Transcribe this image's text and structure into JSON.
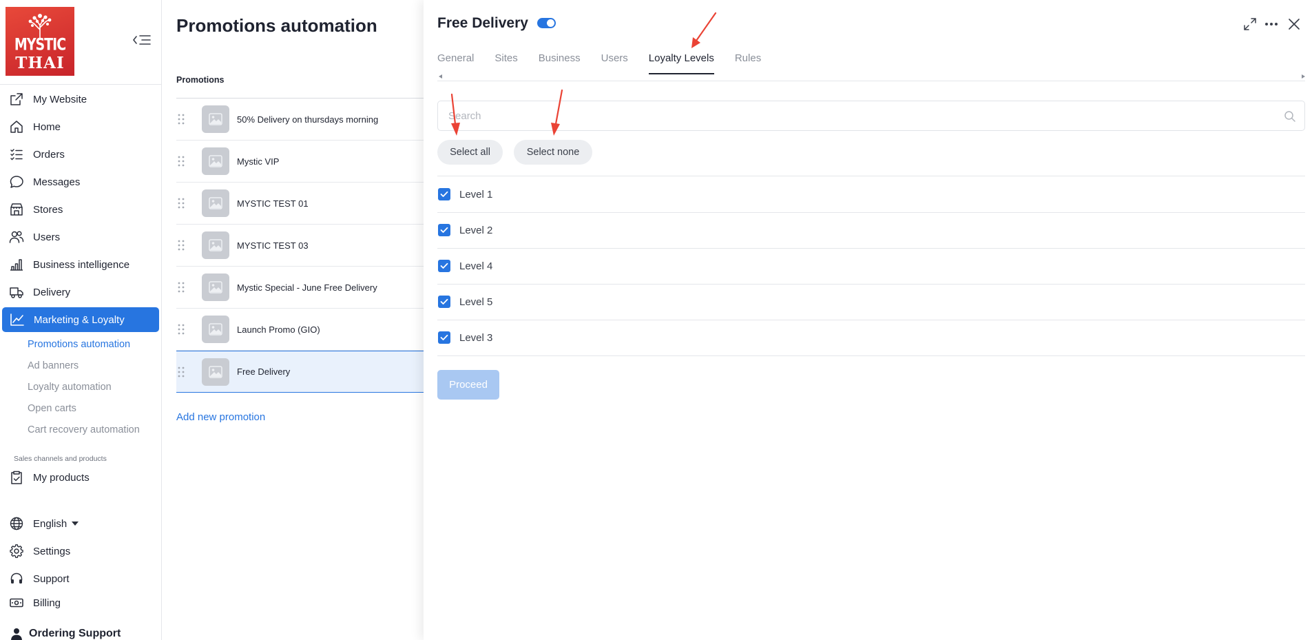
{
  "brand": {
    "logo_line1": "MYSTIC",
    "logo_line2": "THAI"
  },
  "sidebar": {
    "items": [
      {
        "label": "My Website",
        "icon": "external-link-icon"
      },
      {
        "label": "Home",
        "icon": "home-icon"
      },
      {
        "label": "Orders",
        "icon": "list-icon"
      },
      {
        "label": "Messages",
        "icon": "chat-bubble-icon"
      },
      {
        "label": "Stores",
        "icon": "store-icon"
      },
      {
        "label": "Users",
        "icon": "users-icon"
      },
      {
        "label": "Business intelligence",
        "icon": "bar-chart-icon"
      },
      {
        "label": "Delivery",
        "icon": "truck-icon"
      },
      {
        "label": "Marketing & Loyalty",
        "icon": "trend-line-icon",
        "active": true
      }
    ],
    "sub_items": [
      {
        "label": "Promotions automation",
        "active": true
      },
      {
        "label": "Ad banners"
      },
      {
        "label": "Loyalty automation"
      },
      {
        "label": "Open carts"
      },
      {
        "label": "Cart recovery automation"
      }
    ],
    "section_label": "Sales channels and products",
    "products": {
      "label": "My products",
      "icon": "clipboard-check-icon"
    },
    "language": {
      "label": "English",
      "icon": "globe-icon"
    },
    "settings": {
      "label": "Settings",
      "icon": "gear-icon"
    },
    "support": {
      "label": "Support",
      "icon": "headset-icon"
    },
    "billing": {
      "label": "Billing",
      "icon": "cash-icon"
    },
    "account": {
      "label": "Ordering Support",
      "icon": "user-icon"
    }
  },
  "main": {
    "title": "Promotions automation",
    "list_header": "Promotions",
    "promotions": [
      "50% Delivery on thursdays morning",
      "Mystic VIP",
      "MYSTIC TEST 01",
      "MYSTIC TEST 03",
      "Mystic Special - June Free Delivery",
      "Launch Promo (GIO)",
      "Free Delivery"
    ],
    "selected_index": 6,
    "add_link": "Add new promotion"
  },
  "panel": {
    "title": "Free Delivery",
    "enabled": true,
    "tabs": [
      "General",
      "Sites",
      "Business",
      "Users",
      "Loyalty Levels",
      "Rules"
    ],
    "active_tab_index": 4,
    "search_placeholder": "Search",
    "select_all": "Select all",
    "select_none": "Select none",
    "levels": [
      {
        "label": "Level 1",
        "checked": true
      },
      {
        "label": "Level 2",
        "checked": true
      },
      {
        "label": "Level 4",
        "checked": true
      },
      {
        "label": "Level 5",
        "checked": true
      },
      {
        "label": "Level 3",
        "checked": true
      }
    ],
    "proceed": "Proceed"
  },
  "colors": {
    "accent": "#2775e0",
    "annotation_arrow": "#ea4335",
    "logo_red": "#d8322f",
    "proceed_disabled": "#a9c8f2"
  }
}
